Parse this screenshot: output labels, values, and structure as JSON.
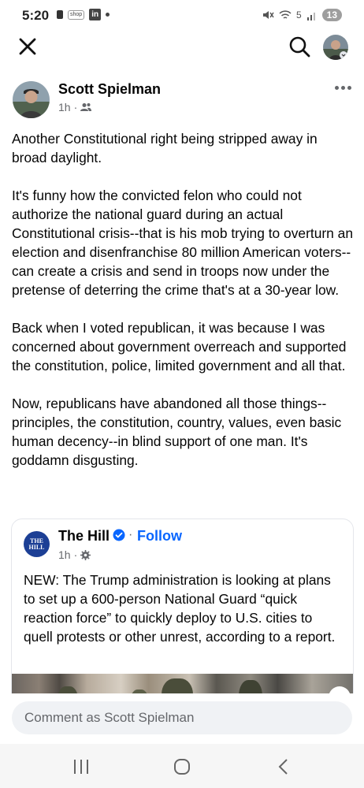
{
  "status_bar": {
    "time": "5:20",
    "shop_label": "shop",
    "linkedin_label": "in",
    "network_label": "5",
    "battery": "13"
  },
  "post": {
    "author": "Scott Spielman",
    "time": "1h",
    "audience_icon": "friends-icon",
    "paragraphs": [
      "Another Constitutional right being stripped away in broad daylight.",
      "It's funny how the convicted felon who could not authorize the national guard during an actual Constitutional crisis--that is his mob trying to overturn an election and disenfranchise 80 million American voters--can create a crisis and send in troops now under the pretense of deterring the crime that's at a 30-year low.",
      "Back when I voted republican, it was because I was concerned about government overreach and supported the constitution, police, limited government and all that.",
      "Now, republicans have abandoned all those things--principles, the constitution, country, values, even basic human decency--in blind support of one man. It's goddamn disgusting."
    ]
  },
  "shared": {
    "logo_text_line1": "THE",
    "logo_text_line2": "HILL",
    "page_name": "The Hill",
    "separator": "·",
    "follow_label": "Follow",
    "time": "1h",
    "text": "NEW: The Trump administration is looking at plans to set up a 600-person National Guard “quick reaction force” to quickly deploy to U.S. cities to quell protests or other unrest, according to a report."
  },
  "comment": {
    "placeholder": "Comment as Scott Spielman"
  },
  "colors": {
    "accent": "#0866ff",
    "hill_logo": "#1c3f95",
    "secondary_text": "#65676b",
    "comment_bg": "#f0f2f5"
  }
}
